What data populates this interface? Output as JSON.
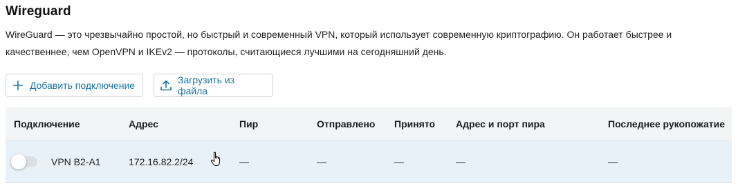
{
  "page": {
    "title": "Wireguard",
    "description": "WireGuard — это чрезвычайно простой, но быстрый и современный VPN, который использует современную криптографию. Он работает быстрее и качественнее, чем OpenVPN и IKEv2 — протоколы, считающиеся лучшими на сегодняшний день."
  },
  "actions": {
    "add_label": "Добавить подключение",
    "add_icon": "plus-icon",
    "upload_label": "Загрузить из файла",
    "upload_icon": "upload-icon"
  },
  "table": {
    "columns": [
      "Подключение",
      "Адрес",
      "Пир",
      "Отправлено",
      "Принято",
      "Адрес и порт пира",
      "Последнее рукопожатие"
    ],
    "rows": [
      {
        "enabled": false,
        "connection": "VPN B2-A1",
        "address": "172.16.82.2/24",
        "peer": "—",
        "sent": "—",
        "received": "—",
        "peer_address": "—",
        "last_handshake": "—"
      }
    ]
  },
  "colors": {
    "accent": "#1a73a6",
    "header_bg": "#f3f4f6",
    "row_bg": "#e9f1f8"
  }
}
